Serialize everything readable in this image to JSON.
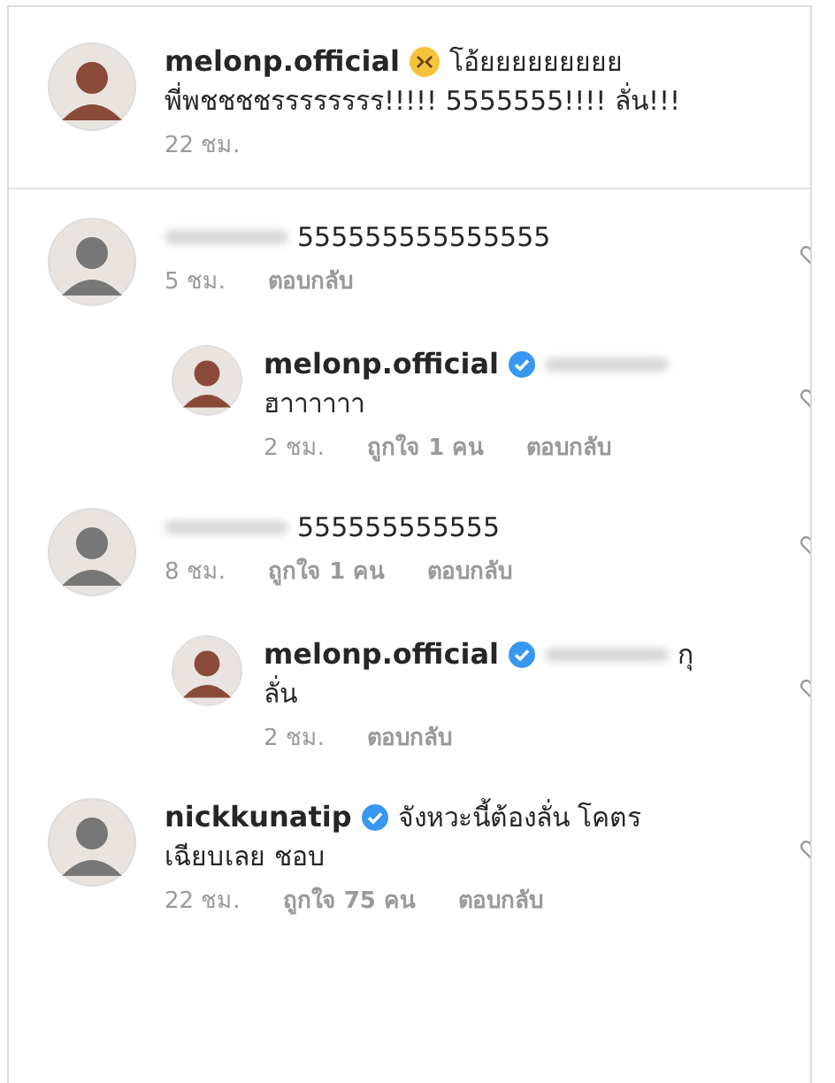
{
  "comments": [
    {
      "kind": "caption",
      "user": "melonp.official",
      "emoji": true,
      "inline_text": "โอ้ยยยยยยยยย",
      "lines": [
        "พี่พชชชชรรรรรรรร!!!!! 5555555!!!! ลั่น!!!"
      ],
      "time": "22 ชม."
    },
    {
      "kind": "comment",
      "name_hidden": true,
      "inline_text": "555555555555555",
      "time": "5 ชม.",
      "reply_label": "ตอบกลับ"
    },
    {
      "kind": "reply",
      "user": "melonp.official",
      "verified": true,
      "mention_hidden": true,
      "lines": [
        "ฮาาาาาา"
      ],
      "time": "2 ชม.",
      "likes": "ถูกใจ 1 คน",
      "reply_label": "ตอบกลับ"
    },
    {
      "kind": "comment",
      "name_hidden": true,
      "inline_text": "555555555555",
      "time": "8 ชม.",
      "likes": "ถูกใจ 1 คน",
      "reply_label": "ตอบกลับ"
    },
    {
      "kind": "reply",
      "user": "melonp.official",
      "verified": true,
      "mention_hidden": true,
      "inline_text": "กุ",
      "lines": [
        "ลั่น"
      ],
      "time": "2 ชม.",
      "reply_label": "ตอบกลับ"
    },
    {
      "kind": "comment",
      "user": "nickkunatip",
      "verified": true,
      "inline_text": "จังหวะนี้ต้องลั่น โคตร",
      "lines": [
        "เฉียบเลย ชอบ"
      ],
      "time": "22 ชม.",
      "likes": "ถูกใจ 75 คน",
      "reply_label": "ตอบกลับ"
    }
  ]
}
